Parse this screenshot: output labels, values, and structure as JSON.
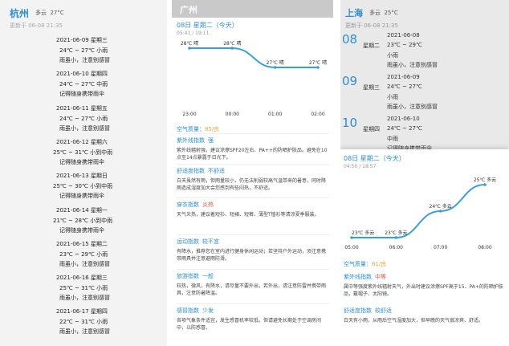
{
  "hangzhou": {
    "city": "杭州",
    "condition": "多云",
    "temp": "27°C",
    "updated": "更新于 06-08 21:35",
    "days": [
      {
        "date": "2021-06-09",
        "week": "星期三",
        "temp": "24℃ ~ 27℃",
        "weather": "小雨",
        "tip": "雨虽小，注意别感冒"
      },
      {
        "date": "2021-06-10",
        "week": "星期四",
        "temp": "24℃ ~ 27℃",
        "weather": "中雨",
        "tip": "记得随身携带雨伞"
      },
      {
        "date": "2021-06-11",
        "week": "星期五",
        "temp": "24℃ ~ 27℃",
        "weather": "小雨",
        "tip": "雨虽小，注意别感冒"
      },
      {
        "date": "2021-06-12",
        "week": "星期六",
        "temp": "25℃ ~ 31℃",
        "weather": "小到中雨",
        "tip": "记得随身携带雨伞"
      },
      {
        "date": "2021-06-13",
        "week": "星期日",
        "temp": "25℃ ~ 30℃",
        "weather": "小到中雨",
        "tip": "记得随身携带雨伞"
      },
      {
        "date": "2021-06-14",
        "week": "星期一",
        "temp": "21℃ ~ 28℃",
        "weather": "小到中雨",
        "tip": "记得随身携带雨伞"
      },
      {
        "date": "2021-06-15",
        "week": "星期二",
        "temp": "23℃ ~ 29℃",
        "weather": "小雨",
        "tip": "雨虽小，注意别感冒"
      },
      {
        "date": "2021-06-16",
        "week": "星期三",
        "temp": "25℃ ~ 31℃",
        "weather": "小雨",
        "tip": "雨虽小，注意别感冒"
      },
      {
        "date": "2021-06-17",
        "week": "星期四",
        "temp": "22℃ ~ 31℃",
        "weather": "小雨",
        "tip": "雨虽小，注意别感冒"
      }
    ]
  },
  "guangzhou": {
    "city": "广州",
    "date_line": "08日 星期二（今天）",
    "sun": "05:41 / 19:11",
    "air_quality_label": "空气质量：",
    "air_quality_value": "85/良",
    "indices": [
      {
        "name": "紫外线指数",
        "level": "强",
        "warn": false,
        "desc": "紫外线辐射强，建议涂擦SPF20左右、PA++的防晒护肤品。避免在10点至14点暴露于日光下。"
      },
      {
        "name": "舒适度指数",
        "level": "不舒适",
        "warn": false,
        "desc": "白天虽然有雨，但雨量较小，仍无法削弱较高气温带来的暑意，同时降雨造成湿度加大会您感到有些闷热，不舒适。"
      },
      {
        "name": "穿衣指数",
        "level": "炎热",
        "warn": true,
        "desc": "天气炎热，建议着短衫、短裙、短裤、薄型T恤衫等清凉夏季服装。"
      },
      {
        "name": "运动指数",
        "level": "较不宜",
        "warn": false,
        "desc": "有降水，推荐您在室内进行健身休闲运动；若坚持户外运动，须注意携带雨具并注意避雨防滑。"
      },
      {
        "name": "旅游指数",
        "level": "一般",
        "warn": false,
        "desc": "较热，微风，有降水，请尽量不要外出，若外出，请注意防雷并携带雨具，注意防暑降温。"
      },
      {
        "name": "感冒指数",
        "level": "少发",
        "warn": false,
        "desc": "各项气象条件适宜，发生感冒机率较低。但请避免长期处于空调房间中，以防感冒。"
      }
    ]
  },
  "shanghai": {
    "city": "上海",
    "condition": "多云",
    "temp": "25°C",
    "updated": "更新于 06-08 21:35",
    "days": [
      {
        "big": "08",
        "week": "星期二",
        "date": "2021-06-08",
        "temp": "23℃ ~ 29℃",
        "weather": "小雨",
        "tip": "雨虽小，注意别感冒"
      },
      {
        "big": "09",
        "week": "星期三",
        "date": "2021-06-09",
        "temp": "24℃ ~ 27℃",
        "weather": "小雨",
        "tip": "雨虽小，注意别感冒"
      },
      {
        "big": "10",
        "week": "星期四",
        "date": "2021-06-10",
        "temp": "24℃ ~ 27℃",
        "weather": "中雨",
        "tip": "记得随身携带雨伞"
      }
    ],
    "date_line": "08日 星期二（今天）",
    "sun": "04:50 / 18:57",
    "air_quality_label": "空气质量：",
    "air_quality_value": "61/良",
    "indices": [
      {
        "name": "紫外线指数",
        "level": "中等",
        "desc": "属中等强度紫外线辐射天气，外出时建议涂擦SPF高于15、PA+的防晒护肤品，戴帽子、太阳镜。"
      },
      {
        "name": "舒适度指数",
        "level": "较舒适",
        "desc": "白天有小雨，从雨后空气湿度加大，但早晚的天气很凉爽、舒适。"
      }
    ]
  },
  "chart_data": [
    {
      "type": "line",
      "x": [
        "23:00",
        "00:00",
        "01:00",
        "02:00"
      ],
      "values": [
        28,
        28,
        27,
        27
      ],
      "point_labels": [
        "28℃ 晴",
        "28℃ 晴",
        "27℃ 晴",
        "27℃ 晴"
      ]
    },
    {
      "type": "line",
      "x": [
        "05:00",
        "06:00",
        "07:00",
        "08:00"
      ],
      "values": [
        23,
        23,
        24,
        25
      ],
      "point_labels": [
        "23℃ 多云",
        "23℃ 多云",
        "24℃ 多云",
        "25℃ 多云"
      ]
    }
  ]
}
